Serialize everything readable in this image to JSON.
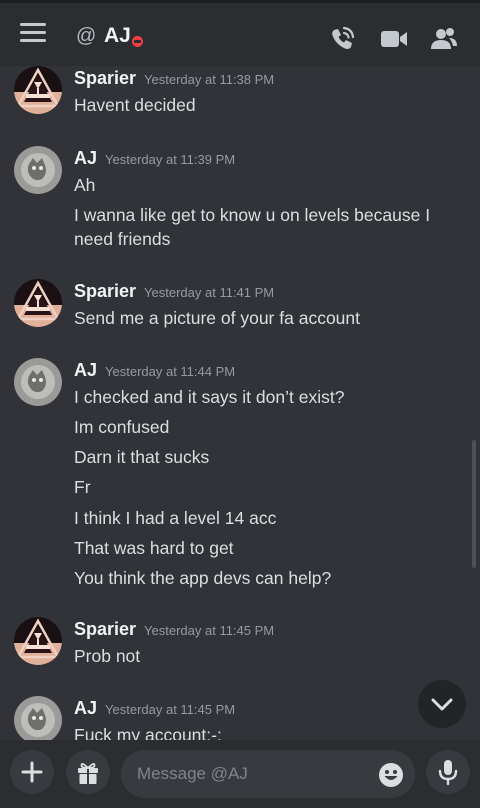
{
  "header": {
    "at_symbol": "@",
    "username": "AJ",
    "status_icon": "do-not-disturb-icon",
    "icons": [
      "menu-icon",
      "voice-call-icon",
      "video-call-icon",
      "members-icon"
    ]
  },
  "messages": [
    {
      "author": "Sparier",
      "timestamp": "Yesterday at 11:38 PM",
      "lines": [
        "Havent decided"
      ]
    },
    {
      "author": "AJ",
      "timestamp": "Yesterday at 11:39 PM",
      "lines": [
        "Ah",
        "I wanna like get to know u on levels because I",
        "need friends"
      ]
    },
    {
      "author": "Sparier",
      "timestamp": "Yesterday at 11:41 PM",
      "lines": [
        "Send me a picture of your fa account"
      ]
    },
    {
      "author": "AJ",
      "timestamp": "Yesterday at 11:44 PM",
      "lines": [
        "I checked and it says it don’t exist?",
        "Im confused",
        "Darn it that sucks",
        "Fr",
        "I think I had a level 14 acc",
        "That was hard to get",
        "You think the app devs can help?"
      ]
    },
    {
      "author": "Sparier",
      "timestamp": "Yesterday at 11:45 PM",
      "lines": [
        "Prob not"
      ]
    },
    {
      "author": "AJ",
      "timestamp": "Yesterday at 11:45 PM",
      "lines": [
        "Fuck my account:-:"
      ]
    }
  ],
  "composer": {
    "placeholder": "Message @AJ",
    "value": "",
    "icons": [
      "plus-icon",
      "gift-icon",
      "emoji-icon",
      "microphone-icon"
    ]
  },
  "colors": {
    "background": "#313338",
    "header": "#2b2d31",
    "text": "#dbdee1",
    "muted": "#949ba4",
    "dnd": "#f23f43"
  }
}
